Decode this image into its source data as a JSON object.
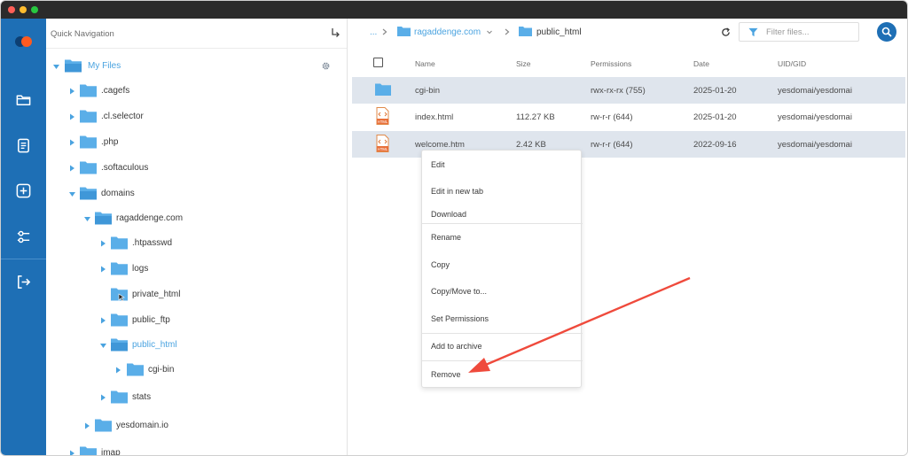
{
  "nav": {
    "title": "Quick Navigation",
    "tree": [
      {
        "label": "My Files",
        "active": true
      },
      {
        "label": ".cagefs"
      },
      {
        "label": ".cl.selector"
      },
      {
        "label": ".php"
      },
      {
        "label": ".softaculous"
      },
      {
        "label": "domains"
      },
      {
        "label": "ragaddenge.com"
      },
      {
        "label": ".htpasswd"
      },
      {
        "label": "logs"
      },
      {
        "label": "private_html"
      },
      {
        "label": "public_ftp"
      },
      {
        "label": "public_html",
        "active": true
      },
      {
        "label": "cgi-bin"
      },
      {
        "label": "stats"
      },
      {
        "label": "yesdomain.io"
      },
      {
        "label": "imap"
      }
    ]
  },
  "breadcrumb": {
    "ellipsis": "...",
    "domain": "ragaddenge.com",
    "current": "public_html"
  },
  "filter": {
    "placeholder": "Filter files..."
  },
  "table": {
    "headers": [
      "Name",
      "Size",
      "Permissions",
      "Date",
      "UID/GID"
    ],
    "rows": [
      {
        "name": "cgi-bin",
        "size": "",
        "permissions": "rwx-rx-rx (755)",
        "date": "2025-01-20",
        "uid": "yesdomai/yesdomai"
      },
      {
        "name": "index.html",
        "size": "112.27 KB",
        "permissions": "rw-r-r (644)",
        "date": "2025-01-20",
        "uid": "yesdomai/yesdomai"
      },
      {
        "name": "welcome.htm",
        "size": "2.42 KB",
        "permissions": "rw-r-r (644)",
        "date": "2022-09-16",
        "uid": "yesdomai/yesdomai"
      }
    ]
  },
  "context_menu": {
    "edit": "Edit",
    "edit_new_tab": "Edit in new tab",
    "download": "Download",
    "rename": "Rename",
    "copy": "Copy",
    "copy_move": "Copy/Move to...",
    "set_permissions": "Set Permissions",
    "add_archive": "Add to archive",
    "remove": "Remove"
  },
  "icons": {
    "rail": [
      "logo-icon",
      "folder-icon",
      "document-icon",
      "add-icon",
      "settings-sliders-icon",
      "logout-icon"
    ],
    "html_badge": "HTML"
  },
  "colors": {
    "rail": "#1e6fb5",
    "folder": "#5aaee8",
    "link": "#4aa3e0",
    "selected_row": "#dfe5ed",
    "annotation_arrow": "#ef4a3c"
  }
}
